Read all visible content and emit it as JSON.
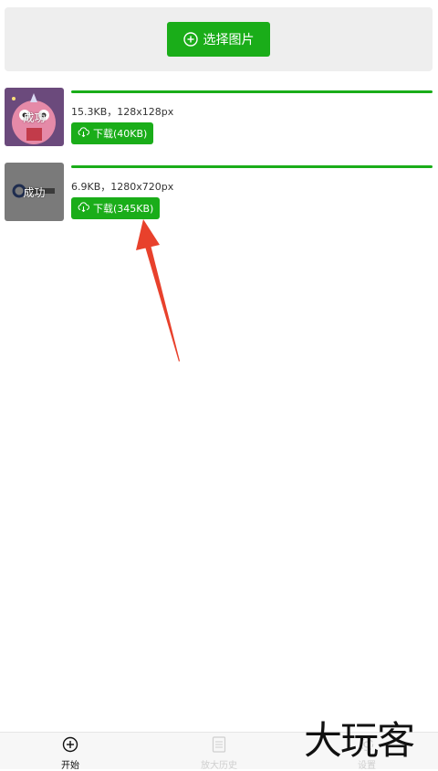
{
  "top": {
    "select_label": "选择图片"
  },
  "items": [
    {
      "thumb_label": "成功",
      "meta": "15.3KB，128x128px",
      "download_label": "下载(40KB)",
      "progress": 1.0
    },
    {
      "thumb_label": "成功",
      "meta": "6.9KB，1280x720px",
      "download_label": "下载(345KB)",
      "progress": 1.0
    }
  ],
  "tabs": [
    {
      "label": "开始",
      "icon": "plus-circle-icon",
      "active": true
    },
    {
      "label": "放大历史",
      "icon": "document-icon",
      "active": false
    },
    {
      "label": "设置",
      "icon": "gear-icon",
      "active": false
    }
  ],
  "watermark": "大玩客",
  "colors": {
    "accent": "#1aad19",
    "panel_bg": "#eeeeee",
    "annotation_arrow": "#e8412c"
  }
}
